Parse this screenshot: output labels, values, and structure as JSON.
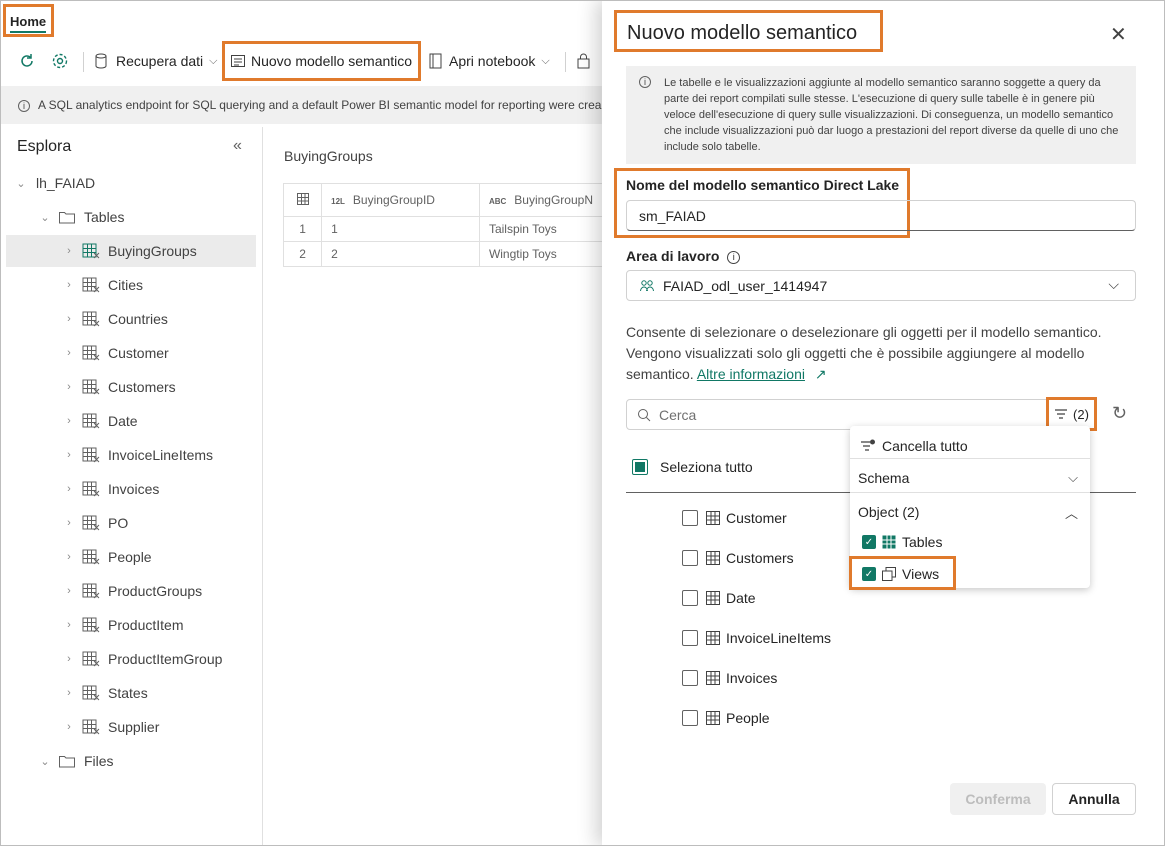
{
  "colors": {
    "accent": "#117865",
    "highlight": "#e07a2c"
  },
  "topbar": {
    "home_tab": "Home"
  },
  "toolbar": {
    "refresh_icon": "refresh-icon",
    "settings_icon": "gear-icon",
    "get_data": "Recupera dati",
    "new_semantic_model": "Nuovo modello semantico",
    "open_notebook": "Apri notebook"
  },
  "infobar": {
    "text": "A SQL analytics endpoint for SQL querying and a default Power BI semantic model for reporting were crea"
  },
  "explorer": {
    "title": "Esplora",
    "root": "lh_FAIAD",
    "tables_folder": "Tables",
    "tables": [
      "BuyingGroups",
      "Cities",
      "Countries",
      "Customer",
      "Customers",
      "Date",
      "InvoiceLineItems",
      "Invoices",
      "PO",
      "People",
      "ProductGroups",
      "ProductItem",
      "ProductItemGroup",
      "States",
      "Supplier"
    ],
    "files_folder": "Files"
  },
  "preview": {
    "title": "BuyingGroups",
    "columns": [
      {
        "type": "12L",
        "name": "BuyingGroupID"
      },
      {
        "type": "ABC",
        "name": "BuyingGroupN"
      }
    ],
    "rows": [
      [
        "1",
        "1",
        "Tailspin Toys"
      ],
      [
        "2",
        "2",
        "Wingtip Toys"
      ]
    ]
  },
  "panel": {
    "title": "Nuovo modello semantico",
    "notice": "Le tabelle e le visualizzazioni aggiunte al modello semantico saranno soggette a query da parte dei report compilati sulle stesse. L'esecuzione di query sulle tabelle è in genere più veloce dell'esecuzione di query sulle visualizzazioni. Di conseguenza, un modello semantico che include visualizzazioni può dar luogo a prestazioni del report diverse da quelle di uno che include solo tabelle.",
    "name_label": "Nome del modello semantico Direct Lake",
    "name_value": "sm_FAIAD",
    "workspace_label": "Area di lavoro",
    "workspace_value": "FAIAD_odl_user_1414947",
    "description": "Consente di selezionare o deselezionare gli oggetti per il modello semantico. Vengono visualizzati solo gli oggetti che è possibile aggiungere al modello semantico.",
    "learn_more": "Altre informazioni",
    "search_placeholder": "Cerca",
    "filter_count": "(2)",
    "select_all": "Seleziona tutto",
    "objects": [
      "Customer",
      "Customers",
      "Date",
      "InvoiceLineItems",
      "Invoices",
      "People"
    ],
    "confirm": "Conferma",
    "cancel": "Annulla"
  },
  "filter_menu": {
    "clear_all": "Cancella tutto",
    "schema": "Schema",
    "object": "Object (2)",
    "options": [
      {
        "label": "Tables",
        "checked": true
      },
      {
        "label": "Views",
        "checked": true
      }
    ]
  }
}
